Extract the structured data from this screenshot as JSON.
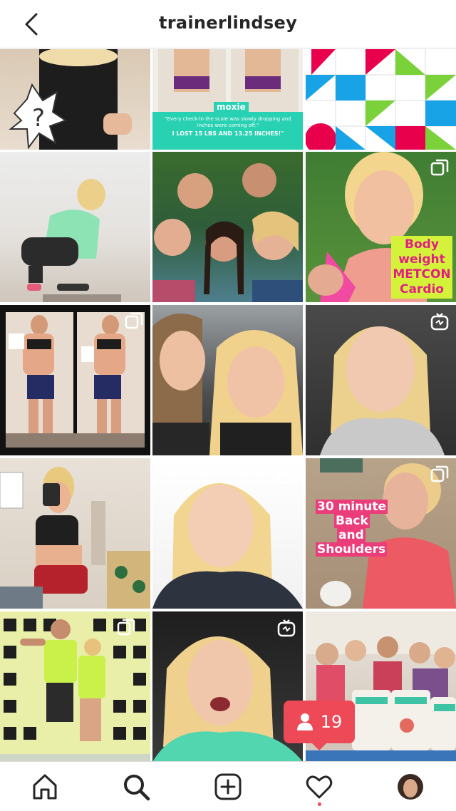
{
  "header": {
    "username": "trainerlindsey",
    "back_icon": "chevron-left-icon"
  },
  "posts": [
    {
      "id": "post-1",
      "text_lines": []
    },
    {
      "id": "post-2",
      "brand": "moxie",
      "quote": "\"Every check-in the scale was slowly dropping and inches were coming off.\"",
      "headline": "I LOST 15 LBS AND 13.25 INCHES!\""
    },
    {
      "id": "post-3",
      "text_lines": []
    },
    {
      "id": "post-4",
      "text_lines": []
    },
    {
      "id": "post-5",
      "text_lines": []
    },
    {
      "id": "post-6",
      "overlay_lines": [
        "Body",
        "weight",
        "METCON",
        "Cardio"
      ],
      "badge": "multiple-posts-icon"
    },
    {
      "id": "post-7",
      "badge": "multiple-posts-icon"
    },
    {
      "id": "post-8"
    },
    {
      "id": "post-9",
      "badge": "igtv-icon"
    },
    {
      "id": "post-10"
    },
    {
      "id": "post-11",
      "badge": "igtv-icon"
    },
    {
      "id": "post-12",
      "overlay_lines": [
        "30 minute",
        "Back",
        "and",
        "Shoulders"
      ],
      "badge": "multiple-posts-icon"
    },
    {
      "id": "post-13",
      "badge": "multiple-posts-icon"
    },
    {
      "id": "post-14",
      "badge": "igtv-icon"
    },
    {
      "id": "post-15"
    }
  ],
  "activity": {
    "count": "19",
    "icon": "person-icon"
  },
  "tabs": [
    {
      "name": "home",
      "icon": "home-icon"
    },
    {
      "name": "search",
      "icon": "search-icon",
      "active": true
    },
    {
      "name": "new-post",
      "icon": "add-square-icon"
    },
    {
      "name": "activity",
      "icon": "heart-icon"
    },
    {
      "name": "profile",
      "icon": "avatar"
    }
  ],
  "colors": {
    "accent_red": "#ed4956",
    "text": "#262626",
    "divider": "#dbdbdb"
  }
}
